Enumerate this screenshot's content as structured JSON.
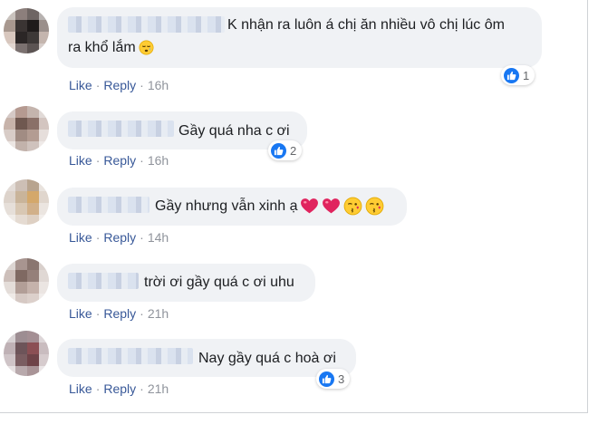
{
  "action_labels": {
    "like": "Like",
    "reply": "Reply",
    "separator": "·"
  },
  "colors": {
    "link": "#385898",
    "like_blue": "#1877f2",
    "bubble_bg": "#f0f2f5",
    "heart": "#e0245e",
    "emoji_yellow": "#ffcc33"
  },
  "comments": [
    {
      "text": "K nhận ra luôn á chị ăn nhiều vô chị lúc ôm",
      "text_line2": "ra khổ lắm",
      "emoji": [
        "sleepy-face"
      ],
      "reactions": "1",
      "time": "16h"
    },
    {
      "text": "Gầy quá nha c ơi",
      "reactions": "2",
      "time": "16h"
    },
    {
      "text": "Gầy nhưng vẫn xinh ạ",
      "emoji": [
        "red-heart",
        "red-heart",
        "kiss-face",
        "kiss-face"
      ],
      "time": "14h"
    },
    {
      "text": "trời ơi gầy quá c ơi uhu",
      "time": "21h"
    },
    {
      "text": "Nay gầy quá c hoà ơi",
      "reactions": "3",
      "time": "21h"
    }
  ]
}
